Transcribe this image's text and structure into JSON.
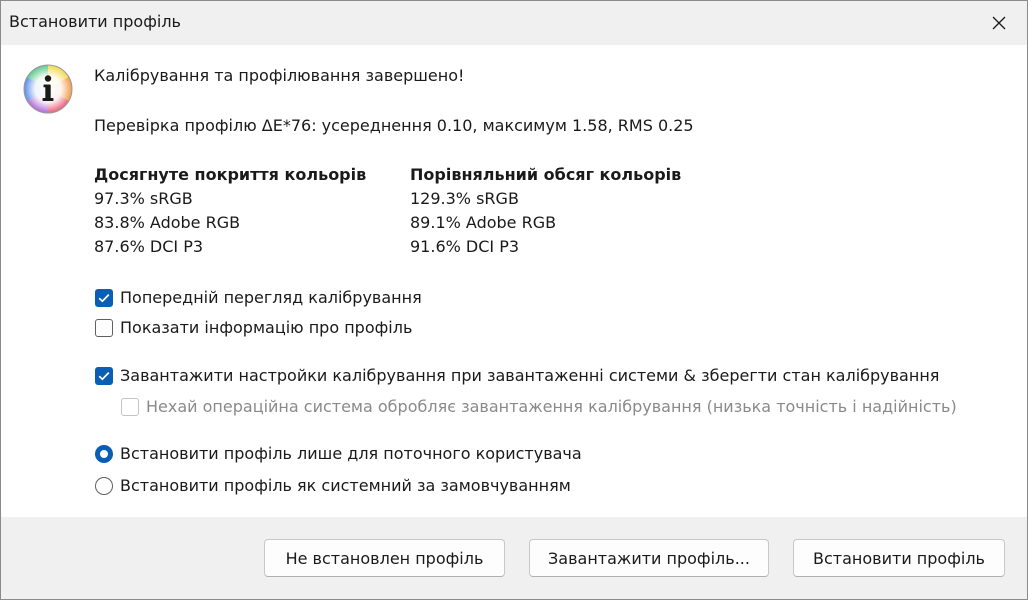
{
  "window": {
    "title": "Встановити профіль"
  },
  "message": {
    "heading": "Калібрування та профілювання завершено!",
    "verification": "Перевірка профілю ΔE*76: усереднення 0.10, максимум 1.58, RMS 0.25"
  },
  "coverage": {
    "achieved": {
      "header": "Досягнуте покриття кольорів",
      "rows": [
        "97.3% sRGB",
        "83.8% Adobe RGB",
        "87.6% DCI P3"
      ]
    },
    "volume": {
      "header": "Порівняльний обсяг кольорів",
      "rows": [
        "129.3% sRGB",
        "89.1% Adobe RGB",
        "91.6% DCI P3"
      ]
    }
  },
  "options": {
    "preview_calibration": {
      "label": "Попередній перегляд калібрування",
      "checked": true
    },
    "show_profile_info": {
      "label": "Показати інформацію про профіль",
      "checked": false
    },
    "load_calibration": {
      "label": "Завантажити настройки калібрування при завантаженні системи & зберегти стан калібрування",
      "checked": true
    },
    "os_handles_loading": {
      "label": "Нехай операційна система обробляє завантаження калібрування (низька точність і надійність)",
      "checked": false,
      "disabled": true
    }
  },
  "install_scope": {
    "current_user": {
      "label": "Встановити профіль лише для поточного користувача",
      "selected": true
    },
    "system_default": {
      "label": "Встановити профіль як системний за замовчуванням",
      "selected": false
    }
  },
  "buttons": {
    "no_profile": "Не встановлен профіль",
    "save_profile": "Завантажити профіль...",
    "install_profile": "Встановити профіль"
  },
  "colors": {
    "accent": "#0a5fb4"
  }
}
